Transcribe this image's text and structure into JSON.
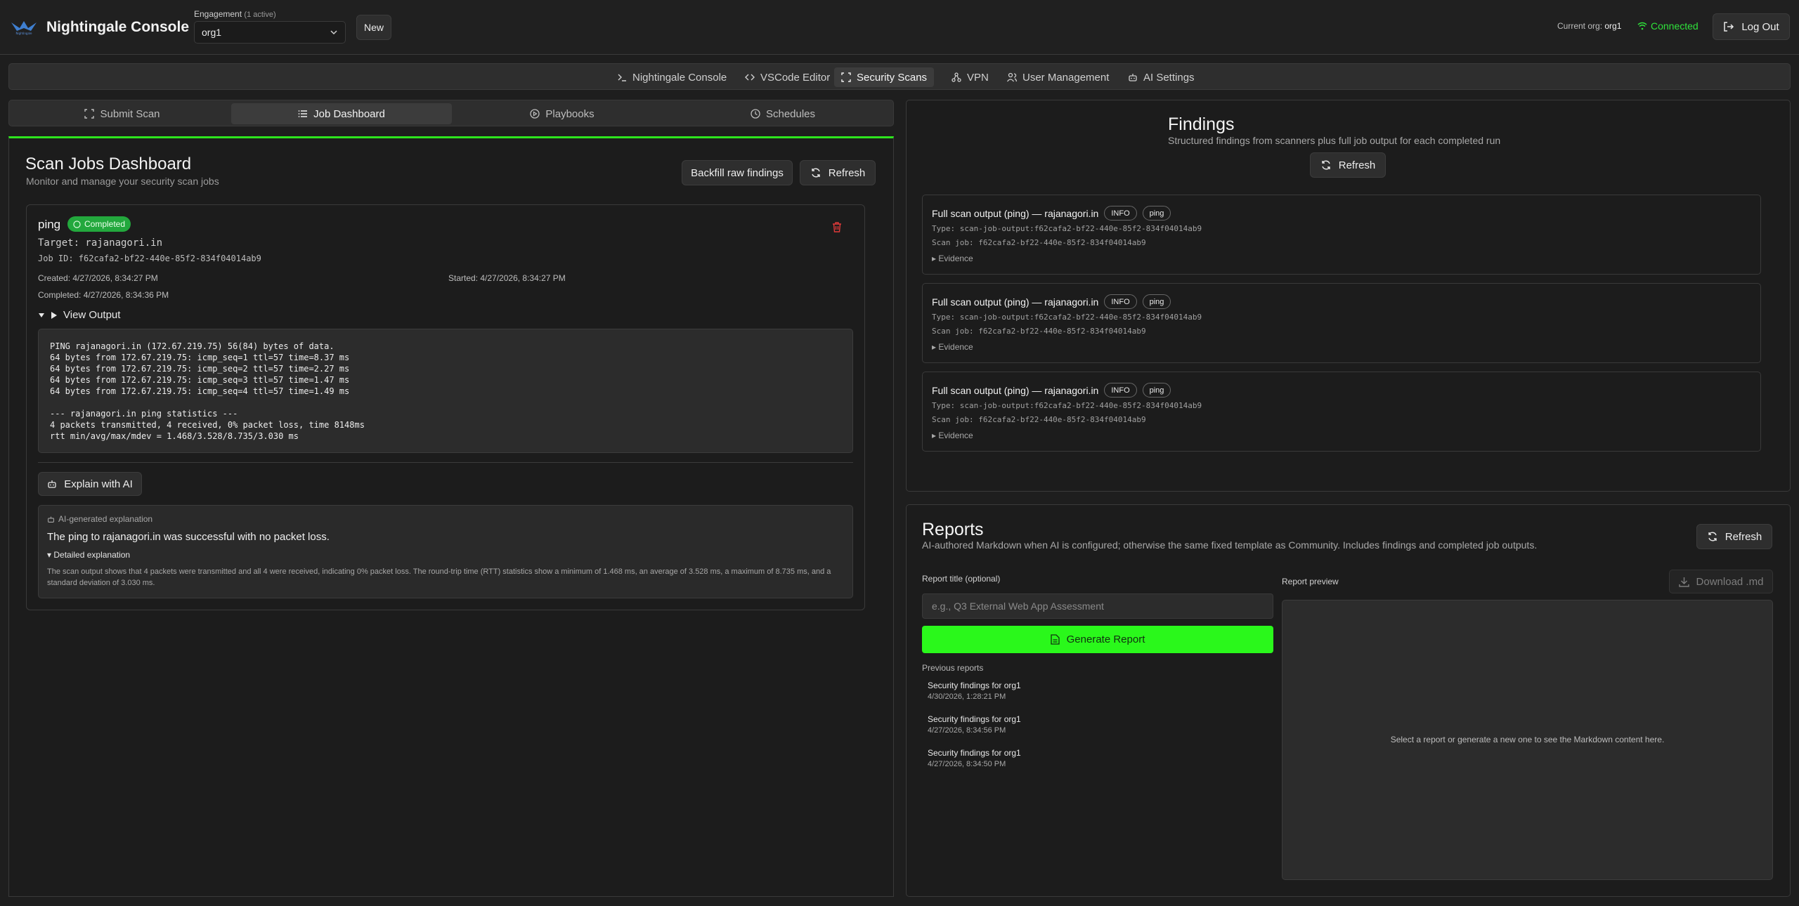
{
  "app": {
    "title": "Nightingale Console",
    "logo_text": "Nightingale"
  },
  "header": {
    "engagement_label": "Engagement",
    "engagement_count": "(1 active)",
    "engagement_value": "org1",
    "new_label": "New",
    "current_org_label": "Current org:",
    "current_org_value": "org1",
    "connection_status": "Connected",
    "logout_label": "Log Out",
    "status_color": "#2fe23b"
  },
  "nav": {
    "items": [
      {
        "label": "Nightingale Console",
        "icon": "terminal-icon"
      },
      {
        "label": "VSCode Editor",
        "icon": "code-icon"
      },
      {
        "label": "Security Scans",
        "icon": "scan-icon",
        "active": true
      },
      {
        "label": "VPN",
        "icon": "network-icon"
      },
      {
        "label": "User Management",
        "icon": "users-icon"
      },
      {
        "label": "AI Settings",
        "icon": "bot-icon"
      }
    ]
  },
  "subtabs": {
    "items": [
      {
        "label": "Submit Scan",
        "icon": "scan-icon"
      },
      {
        "label": "Job Dashboard",
        "icon": "list-icon",
        "active": true
      },
      {
        "label": "Playbooks",
        "icon": "play-circle-icon"
      },
      {
        "label": "Schedules",
        "icon": "clock-icon"
      }
    ]
  },
  "dashboard": {
    "title": "Scan Jobs Dashboard",
    "subtitle": "Monitor and manage your security scan jobs",
    "backfill_label": "Backfill raw findings",
    "refresh_label": "Refresh",
    "accent_color": "#2ee51e"
  },
  "job": {
    "name": "ping",
    "status": "Completed",
    "target": "Target: rajanagori.in",
    "job_id": "Job ID: f62cafa2-bf22-440e-85f2-834f04014ab9",
    "created": "Created: 4/27/2026, 8:34:27 PM",
    "started": "Started: 4/27/2026, 8:34:27 PM",
    "completed": "Completed: 4/27/2026, 8:34:36 PM",
    "view_output_label": "View Output",
    "output": "PING rajanagori.in (172.67.219.75) 56(84) bytes of data.\n64 bytes from 172.67.219.75: icmp_seq=1 ttl=57 time=8.37 ms\n64 bytes from 172.67.219.75: icmp_seq=2 ttl=57 time=2.27 ms\n64 bytes from 172.67.219.75: icmp_seq=3 ttl=57 time=1.47 ms\n64 bytes from 172.67.219.75: icmp_seq=4 ttl=57 time=1.49 ms\n\n--- rajanagori.in ping statistics ---\n4 packets transmitted, 4 received, 0% packet loss, time 8148ms\nrtt min/avg/max/mdev = 1.468/3.528/8.735/3.030 ms",
    "explain_label": "Explain with AI",
    "ai_label": "AI-generated explanation",
    "ai_summary": "The ping to rajanagori.in was successful with no packet loss.",
    "ai_detail_toggle": "Detailed explanation",
    "ai_detail": "The scan output shows that 4 packets were transmitted and all 4 were received, indicating 0% packet loss. The round-trip time (RTT) statistics show a minimum of 1.468 ms, an average of 3.528 ms, a maximum of 8.735 ms, and a standard deviation of 3.030 ms.",
    "status_color": "#23a83d",
    "delete_color": "#e03a3a"
  },
  "findings": {
    "title": "Findings",
    "subtitle": "Structured findings from scanners plus full job output for each completed run",
    "refresh_label": "Refresh",
    "items": [
      {
        "title": "Full scan output (ping) — rajanagori.in",
        "severity": "INFO",
        "tool": "ping",
        "type": "Type: scan-job-output:f62cafa2-bf22-440e-85f2-834f04014ab9",
        "scan_job": "Scan job: f62cafa2-bf22-440e-85f2-834f04014ab9",
        "evidence": "Evidence"
      },
      {
        "title": "Full scan output (ping) — rajanagori.in",
        "severity": "INFO",
        "tool": "ping",
        "type": "Type: scan-job-output:f62cafa2-bf22-440e-85f2-834f04014ab9",
        "scan_job": "Scan job: f62cafa2-bf22-440e-85f2-834f04014ab9",
        "evidence": "Evidence"
      },
      {
        "title": "Full scan output (ping) — rajanagori.in",
        "severity": "INFO",
        "tool": "ping",
        "type": "Type: scan-job-output:f62cafa2-bf22-440e-85f2-834f04014ab9",
        "scan_job": "Scan job: f62cafa2-bf22-440e-85f2-834f04014ab9",
        "evidence": "Evidence"
      }
    ]
  },
  "reports": {
    "title": "Reports",
    "subtitle": "AI-authored Markdown when AI is configured; otherwise the same fixed template as Community. Includes findings and completed job outputs.",
    "refresh_label": "Refresh",
    "title_label": "Report title (optional)",
    "title_placeholder": "e.g., Q3 External Web App Assessment",
    "title_value": "",
    "generate_label": "Generate Report",
    "previous_label": "Previous reports",
    "previous": [
      {
        "title": "Security findings for org1",
        "date": "4/30/2026, 1:28:21 PM"
      },
      {
        "title": "Security findings for org1",
        "date": "4/27/2026, 8:34:56 PM"
      },
      {
        "title": "Security findings for org1",
        "date": "4/27/2026, 8:34:50 PM"
      }
    ],
    "preview_label": "Report preview",
    "download_label": "Download .md",
    "preview_placeholder": "Select a report or generate a new one to see the Markdown content here.",
    "generate_color": "#2af81b"
  }
}
